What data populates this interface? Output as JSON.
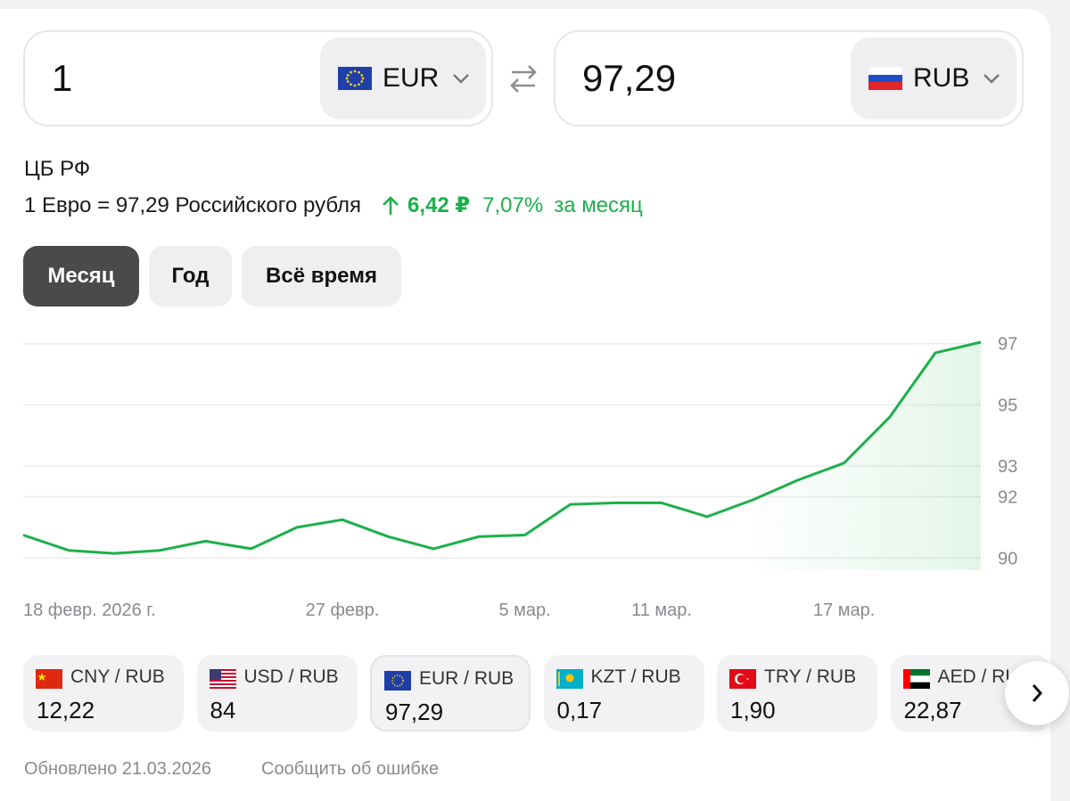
{
  "converter": {
    "from": {
      "amount": "1",
      "currency": "EUR",
      "flag": "eu-flag-icon"
    },
    "to": {
      "amount": "97,29",
      "currency": "RUB",
      "flag": "ru-flag-icon"
    }
  },
  "source": "ЦБ РФ",
  "rate": {
    "text": "1 Евро = 97,29 Российского рубля",
    "change_abs": "6,42 ₽",
    "change_pct": "7,07%",
    "period": "за месяц",
    "color": "#1cb04a"
  },
  "tabs": [
    {
      "label": "Месяц",
      "active": true
    },
    {
      "label": "Год",
      "active": false
    },
    {
      "label": "Всё время",
      "active": false
    }
  ],
  "chart_data": {
    "type": "area",
    "x": [
      "18 февр.",
      "19 февр.",
      "20 февр.",
      "21 февр.",
      "24 февр.",
      "25 февр.",
      "26 февр.",
      "27 февр.",
      "28 февр.",
      "3 мар.",
      "4 мар.",
      "5 мар.",
      "6 мар.",
      "7 мар.",
      "11 мар.",
      "12 мар.",
      "13 мар.",
      "14 мар.",
      "17 мар.",
      "18 мар.",
      "19 мар.",
      "20 мар.",
      "21 мар."
    ],
    "values": [
      90.75,
      90.25,
      90.15,
      90.25,
      90.55,
      90.3,
      91.0,
      91.25,
      90.7,
      90.3,
      90.7,
      90.75,
      91.75,
      91.8,
      91.8,
      91.35,
      91.9,
      92.55,
      93.1,
      94.6,
      96.7,
      97.05
    ],
    "y_ticks": [
      "90",
      "92",
      "93",
      "95",
      "97"
    ],
    "y_tick_values": [
      90,
      92,
      93,
      95,
      97
    ],
    "x_tick_labels": [
      "18 февр. 2026 г.",
      "27 февр.",
      "5 мар.",
      "11 мар.",
      "17 мар."
    ],
    "ylim": [
      89.6,
      97.4
    ],
    "grid": true,
    "line_color": "#1cb04a"
  },
  "pairs": [
    {
      "label": "CNY / RUB",
      "value": "12,22",
      "flag": "cn-flag-icon",
      "selected": false
    },
    {
      "label": "USD / RUB",
      "value": "84",
      "flag": "us-flag-icon",
      "selected": false
    },
    {
      "label": "EUR / RUB",
      "value": "97,29",
      "flag": "eu-flag-icon",
      "selected": true
    },
    {
      "label": "KZT / RUB",
      "value": "0,17",
      "flag": "kz-flag-icon",
      "selected": false
    },
    {
      "label": "TRY / RUB",
      "value": "1,90",
      "flag": "tr-flag-icon",
      "selected": false
    },
    {
      "label": "AED / RUB",
      "value": "22,87",
      "flag": "ae-flag-icon",
      "selected": false
    }
  ],
  "footer": {
    "updated": "Обновлено 21.03.2026",
    "report": "Сообщить об ошибке"
  }
}
